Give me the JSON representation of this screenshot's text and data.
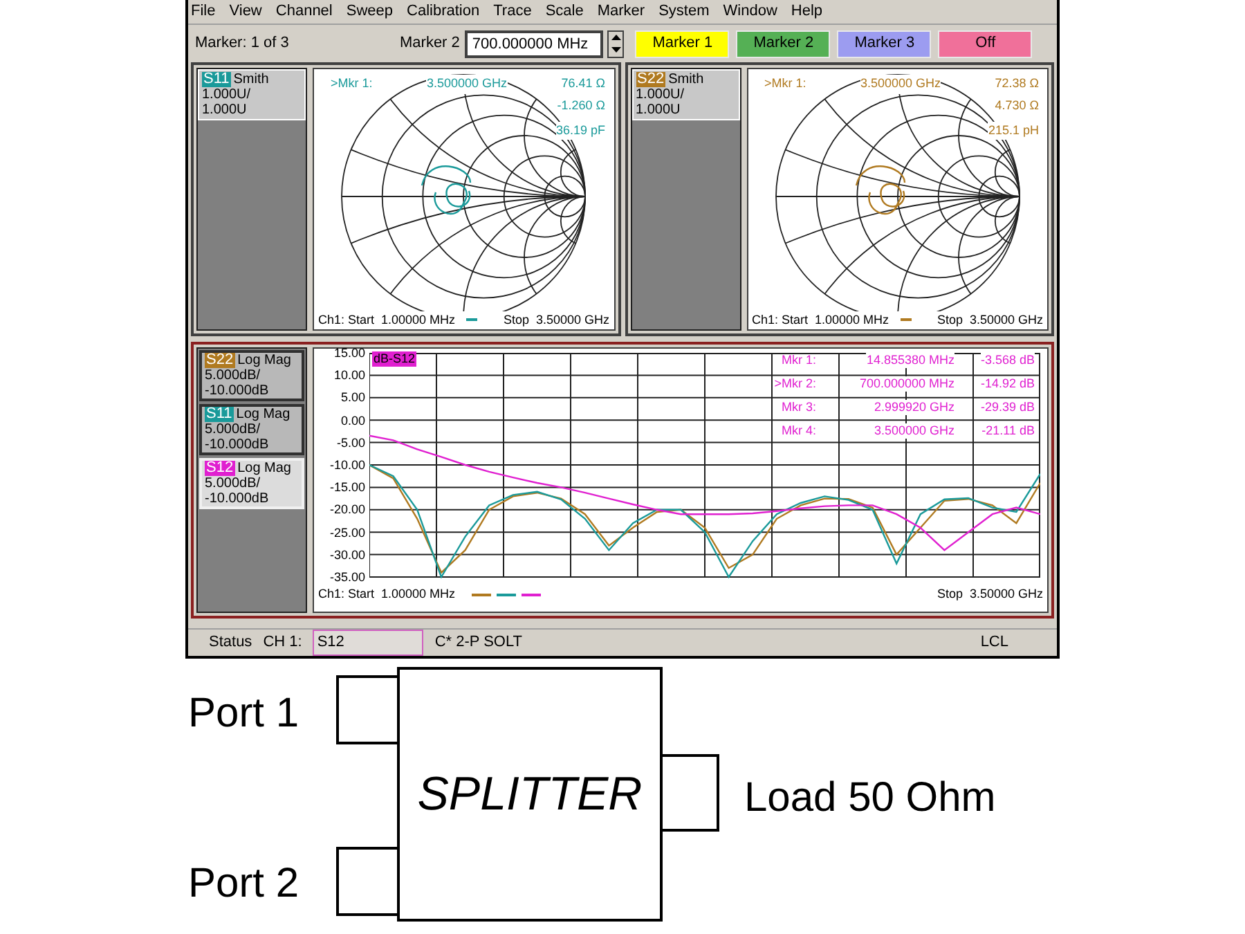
{
  "menu": [
    "File",
    "View",
    "Channel",
    "Sweep",
    "Calibration",
    "Trace",
    "Scale",
    "Marker",
    "System",
    "Window",
    "Help"
  ],
  "toolbar": {
    "marker_status": "Marker: 1 of 3",
    "marker_label": "Marker 2",
    "marker_value": "700.000000 MHz",
    "buttons": [
      {
        "label": "Marker 1",
        "color": "#ffff00"
      },
      {
        "label": "Marker 2",
        "color": "#55b055"
      },
      {
        "label": "Marker 3",
        "color": "#9c9cf0"
      },
      {
        "label": "Off",
        "color": "#f0709a"
      }
    ]
  },
  "smith_panels": [
    {
      "trace": "S11",
      "format": "Smith",
      "scale": "1.000U/",
      "ref": "1.000U",
      "color": "#1a9a9a",
      "readouts": [
        ">Mkr 1:",
        "3.500000 GHz",
        "76.41 Ω",
        "-1.260 Ω",
        "36.19 pF"
      ],
      "start": "Ch1: Start  1.00000 MHz",
      "stop": "Stop  3.50000 GHz"
    },
    {
      "trace": "S22",
      "format": "Smith",
      "scale": "1.000U/",
      "ref": "1.000U",
      "color": "#b07a20",
      "readouts": [
        ">Mkr 1:",
        "3.500000 GHz",
        "72.38 Ω",
        "4.730 Ω",
        "215.1 pH"
      ],
      "start": "Ch1: Start  1.00000 MHz",
      "stop": "Stop  3.50000 GHz"
    }
  ],
  "logmag": {
    "traces": [
      {
        "format": "Log Mag",
        "scale": "5.000dB/",
        "ref": "-10.000dB",
        "selected": false
      },
      {
        "format": "Log Mag",
        "scale": "5.000dB/",
        "ref": "-10.000dB",
        "selected": false
      },
      {
        "format": "Log Mag",
        "scale": "5.000dB/",
        "ref": "-10.000dB",
        "selected": true
      }
    ],
    "label": "dB-S12",
    "chart_data": {
      "type": "line",
      "grid": true,
      "ylim": [
        -35,
        15
      ],
      "yticks": [
        {
          "value": 15,
          "label": "15.00"
        },
        {
          "value": 10,
          "label": "10.00"
        },
        {
          "value": 5,
          "label": "5.00"
        },
        {
          "value": 0,
          "label": "0.00"
        },
        {
          "value": -5,
          "label": "-5.00"
        },
        {
          "value": -10,
          "label": "-10.00"
        },
        {
          "value": -15,
          "label": "-15.00"
        },
        {
          "value": -20,
          "label": "-20.00"
        },
        {
          "value": -25,
          "label": "-25.00"
        },
        {
          "value": -30,
          "label": "-30.00"
        },
        {
          "value": -35,
          "label": "-35.00"
        }
      ],
      "series": [
        {
          "name": "S22",
          "color": "#b07a20",
          "values": [
            -10,
            -13,
            -22,
            -34,
            -29,
            -20,
            -17,
            -16.2,
            -17.5,
            -21,
            -28,
            -24,
            -20.5,
            -20,
            -24,
            -33,
            -30,
            -22,
            -19,
            -17.5,
            -17.6,
            -19.5,
            -30,
            -24,
            -18,
            -17.6,
            -19,
            -23,
            -14
          ]
        },
        {
          "name": "S11",
          "color": "#1a9a9a",
          "values": [
            -10,
            -12.5,
            -20,
            -35,
            -26,
            -19,
            -16.7,
            -16,
            -17.7,
            -22,
            -29,
            -23,
            -20,
            -20,
            -25,
            -35,
            -27,
            -21,
            -18.5,
            -17,
            -17.8,
            -20,
            -32,
            -21,
            -17.7,
            -17.4,
            -19.5,
            -20.5,
            -12
          ]
        },
        {
          "name": "S12",
          "color": "#e020d0",
          "values": [
            -3.5,
            -4.5,
            -6.5,
            -8.2,
            -10,
            -11.5,
            -12.8,
            -14,
            -15,
            -16.2,
            -17.5,
            -18.8,
            -20,
            -21,
            -21,
            -21,
            -20.8,
            -20.3,
            -19.7,
            -19.2,
            -19,
            -19,
            -21,
            -24,
            -29,
            -25,
            -21,
            -19.5,
            -21
          ]
        }
      ]
    },
    "markers": [
      {
        "label": "Mkr 1:",
        "freq": "14.855380 MHz",
        "value": "-3.568 dB"
      },
      {
        "label": ">Mkr 2:",
        "freq": "700.000000 MHz",
        "value": "-14.92 dB"
      },
      {
        "label": "Mkr 3:",
        "freq": "2.999920 GHz",
        "value": "-29.39 dB"
      },
      {
        "label": "Mkr 4:",
        "freq": "3.500000 GHz",
        "value": "-21.11 dB"
      }
    ],
    "start": "Ch1: Start  1.00000 MHz",
    "stop": "Stop  3.50000 GHz"
  },
  "status_bar": {
    "status": "Status",
    "channel": "CH 1:",
    "trace": "S12",
    "calibration": "C* 2-P SOLT",
    "mode": "LCL"
  },
  "diagram": {
    "port_1": "Port 1",
    "port_2": "Port 2",
    "block": "SPLITTER",
    "load": "Load 50 Ohm"
  }
}
